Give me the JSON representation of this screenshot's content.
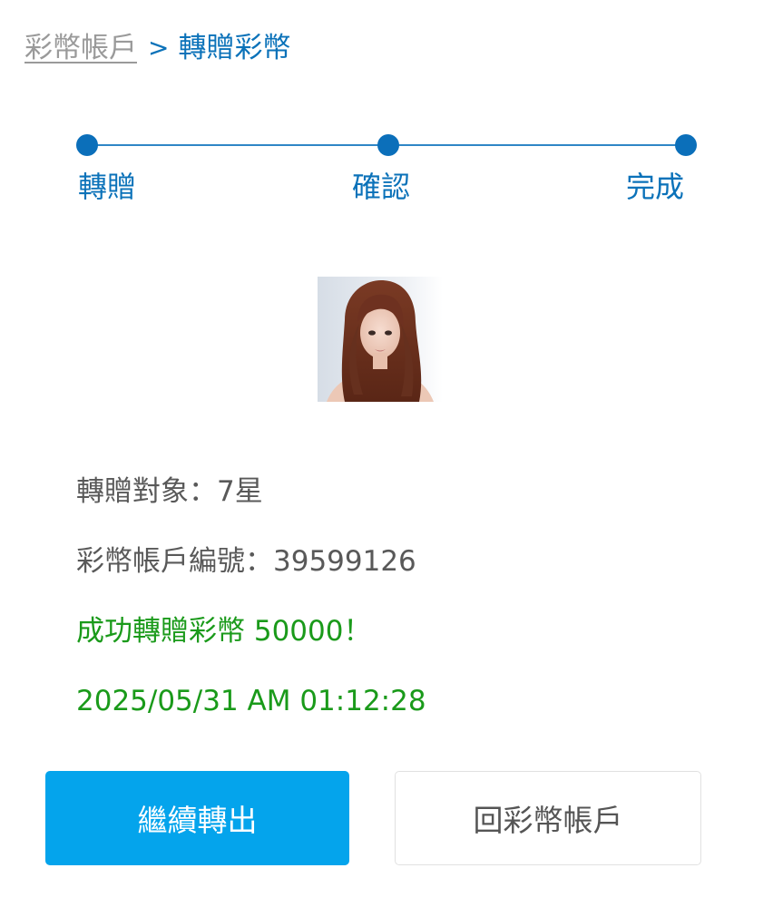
{
  "breadcrumb": {
    "parent": "彩幣帳戶",
    "separator": ">",
    "current": "轉贈彩幣"
  },
  "steps": [
    {
      "label": "轉贈"
    },
    {
      "label": "確認"
    },
    {
      "label": "完成"
    }
  ],
  "colors": {
    "accent_blue": "#0b72b9",
    "success_green": "#1a9a1a",
    "primary_button": "#04a4ec"
  },
  "recipient": {
    "line": "轉贈對象：7星"
  },
  "account": {
    "line": "彩幣帳戶編號：39599126"
  },
  "result": {
    "message": "成功轉贈彩幣 50000！",
    "timestamp": "2025/05/31 AM 01:12:28"
  },
  "buttons": {
    "continue_label": "繼續轉出",
    "back_label": "回彩幣帳戶"
  }
}
